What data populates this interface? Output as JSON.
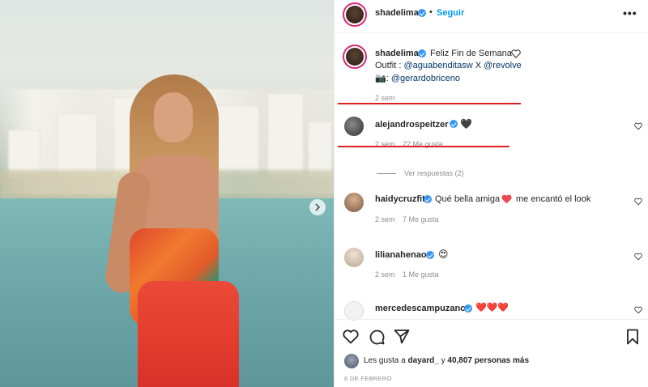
{
  "post": {
    "author": "shadelima",
    "follow_label": "Seguir",
    "dot": "•",
    "more_label": "•••"
  },
  "caption": {
    "author": "shadelima",
    "line1": "Feliz Fin de Semana",
    "line2_prefix": "Outfit : ",
    "mention1": "@aguabenditasw",
    "line2_mid": " X ",
    "mention2": "@revolve",
    "line3_prefix": "📷: ",
    "mention3": "@gerardobriceno",
    "time": "2 sem"
  },
  "comments": [
    {
      "user": "alejandrospeitzer",
      "text": "",
      "emoji": "🖤",
      "time": "2 sem",
      "likes": "22 Me gusta"
    },
    {
      "user": "haidycruzfit",
      "text": "Qué bella amiga",
      "emoji": "❤️",
      "text2": "me encantó el look",
      "time": "2 sem",
      "likes": "7 Me gusta"
    },
    {
      "user": "lilianahenao",
      "text": "",
      "emoji": "😍",
      "time": "2 sem",
      "likes": "1 Me gusta"
    },
    {
      "user": "mercedescampuzano",
      "text": "",
      "emoji": "❤️❤️❤️",
      "time": "",
      "likes": ""
    }
  ],
  "replies_label": "Ver respuestas (2)",
  "likes_summary": {
    "prefix": "Les gusta a ",
    "user": "dayard_",
    "middle": " y ",
    "count": "40,807 personas más"
  },
  "date": "6 DE FEBRERO",
  "colors": {
    "accent": "#0095f6",
    "verified": "#3897f0",
    "annotation_red": "#e02020",
    "heart_red": "#ed4956"
  },
  "icons": [
    "heart-icon",
    "comment-icon",
    "share-icon",
    "bookmark-icon",
    "chevron-right-icon",
    "verified-icon"
  ]
}
